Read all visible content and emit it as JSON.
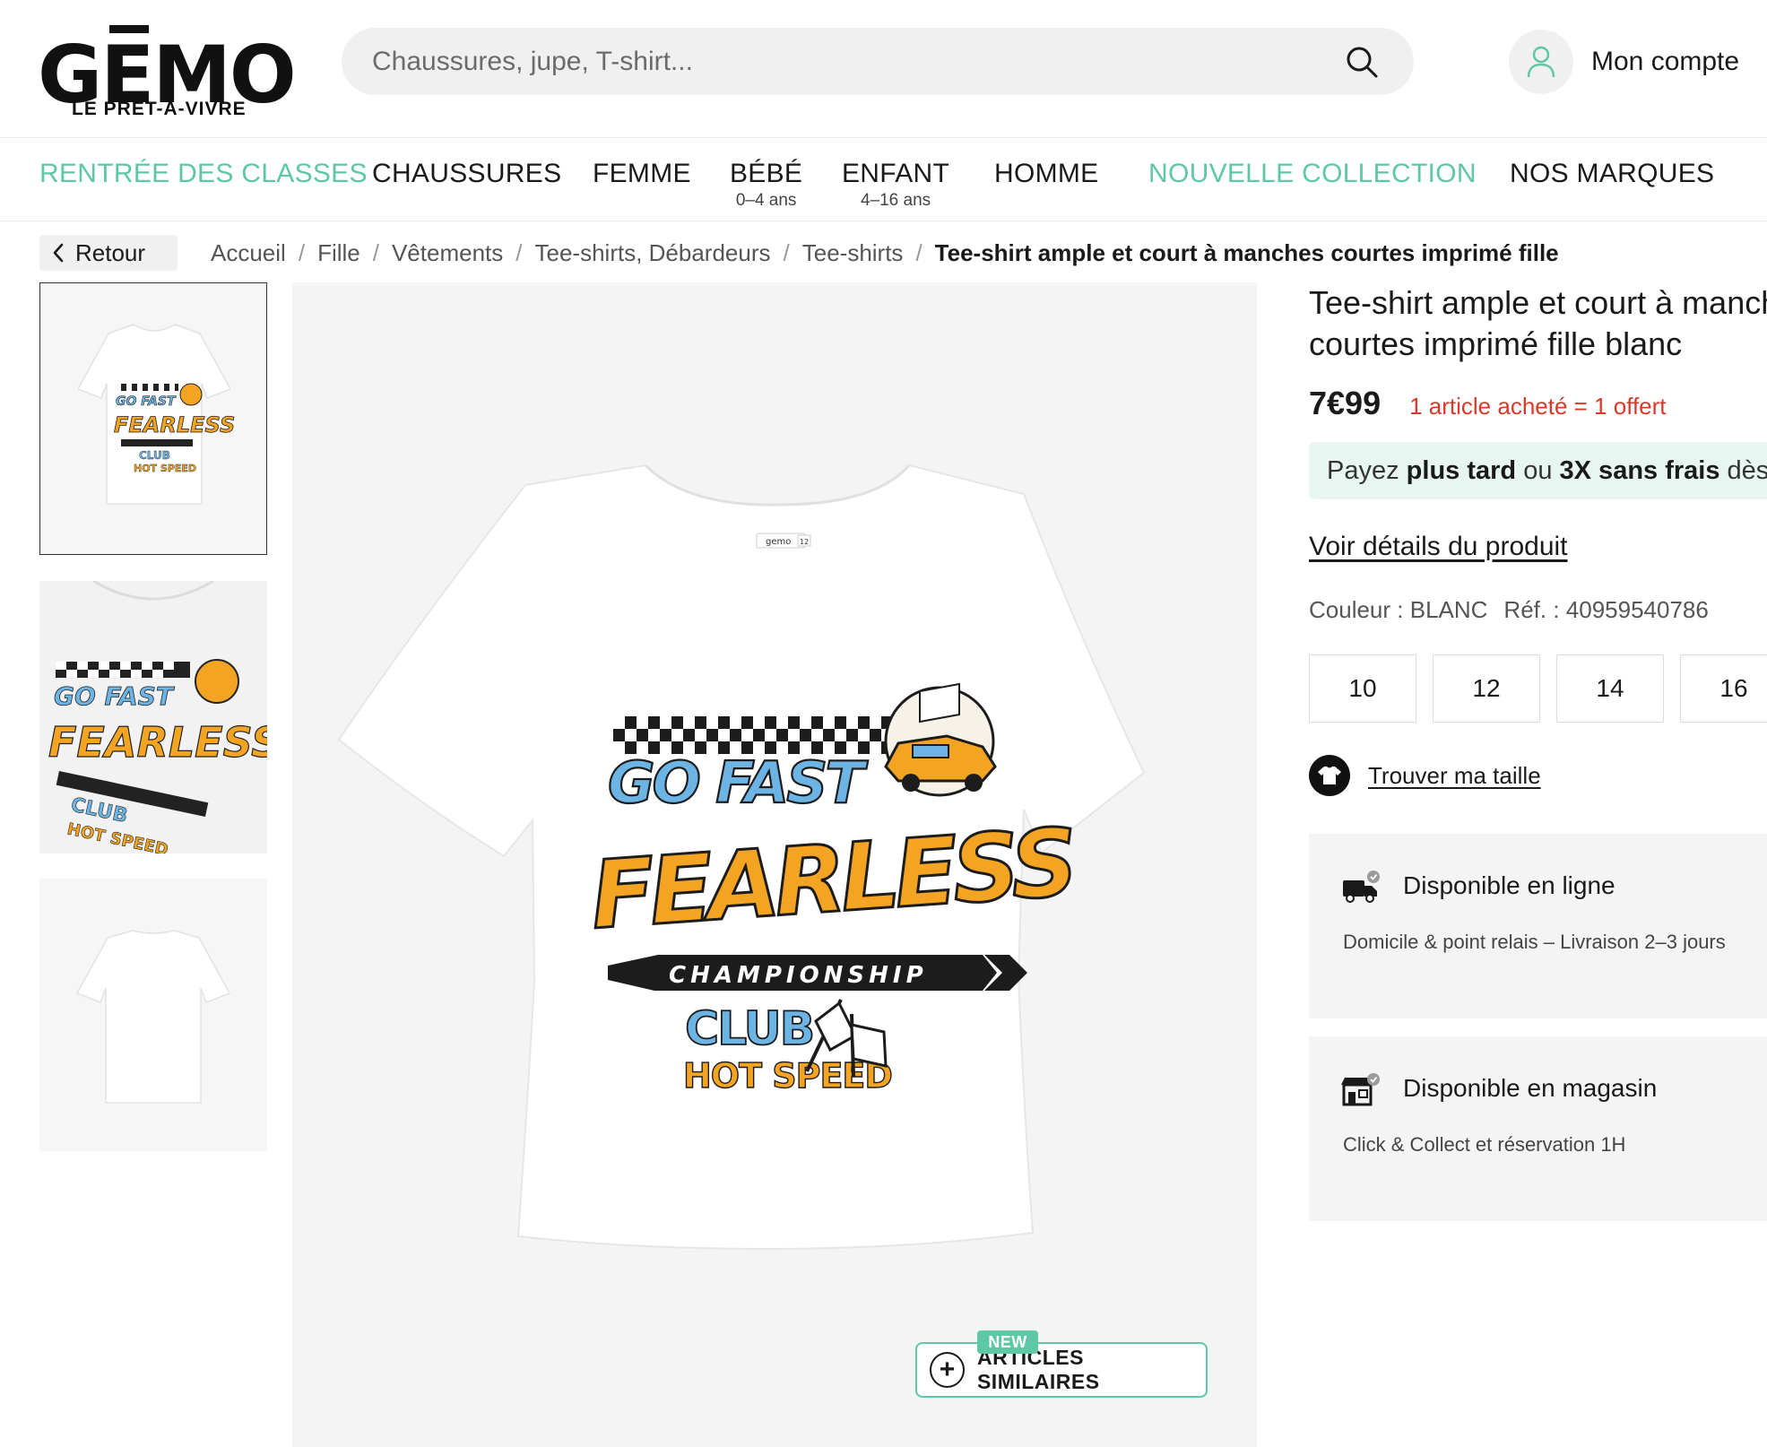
{
  "logo": {
    "wordmark": "GEMO",
    "tagline": "LE PRÊT-À-VIVRE"
  },
  "search": {
    "placeholder": "Chaussures, jupe, T-shirt..."
  },
  "account": {
    "label": "Mon compte"
  },
  "nav": {
    "items": [
      {
        "label": "RENTRÉE DES CLASSES",
        "sub": ""
      },
      {
        "label": "CHAUSSURES",
        "sub": ""
      },
      {
        "label": "FEMME",
        "sub": ""
      },
      {
        "label": "BÉBÉ",
        "sub": "0–4 ans"
      },
      {
        "label": "ENFANT",
        "sub": "4–16 ans"
      },
      {
        "label": "HOMME",
        "sub": ""
      },
      {
        "label": "NOUVELLE COLLECTION",
        "sub": ""
      },
      {
        "label": "NOS MARQUES",
        "sub": ""
      }
    ]
  },
  "back": {
    "label": "Retour"
  },
  "breadcrumb": [
    "Accueil",
    "Fille",
    "Vêtements",
    "Tee-shirts, Débardeurs",
    "Tee-shirts",
    "Tee-shirt ample et court à manches courtes imprimé fille"
  ],
  "gallery": {
    "print": {
      "line1": "GO FAST",
      "line2": "FEARLESS",
      "line3": "CHAMPIONSHIP",
      "line4": "CLUB",
      "line5": "HOT SPEED"
    },
    "label_text": "gemo",
    "label_size": "12"
  },
  "similar": {
    "badge": "NEW",
    "label": "ARTICLES SIMILAIRES"
  },
  "product": {
    "title": "Tee-shirt ample et court à manches courtes imprimé fille blanc",
    "price": "7€99",
    "promo": "1 article acheté = 1 offert",
    "pay": {
      "prefix": "Payez ",
      "later": "plus tard",
      "or": " ou ",
      "three": "3X sans frais",
      "suffix": " dès"
    },
    "details_link": "Voir détails du produit",
    "color_label": "Couleur : BLANC",
    "ref_label": "Réf. : 40959540786",
    "sizes": [
      "10",
      "12",
      "14",
      "16"
    ],
    "find_size": "Trouver ma taille",
    "availability": {
      "online": {
        "title": "Disponible en ligne",
        "desc": "Domicile & point relais – Livraison 2–3 jours"
      },
      "store": {
        "title": "Disponible en magasin",
        "desc": "Click & Collect et réservation 1H"
      }
    }
  },
  "colors": {
    "accent": "#5ec7a6",
    "promo": "#d9392b",
    "pay_bg": "#e8f6f1",
    "print_orange": "#f3a422",
    "print_blue": "#6cb4e4"
  },
  "icons": {
    "search": "search-icon",
    "account": "user-icon",
    "back": "chevron-left-icon",
    "similar": "plus-circle-icon",
    "find_size": "tshirt-icon",
    "online": "truck-icon",
    "store": "store-icon"
  }
}
